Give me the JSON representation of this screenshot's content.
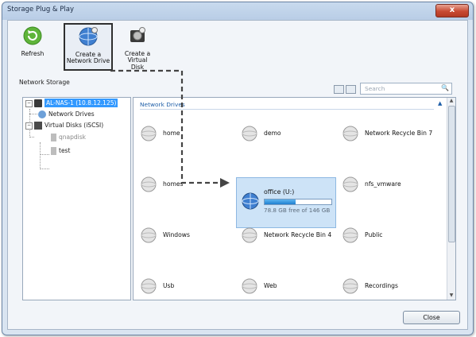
{
  "window": {
    "title": "Storage Plug & Play",
    "close_glyph": "x"
  },
  "toolbar": {
    "refresh_label": "Refresh",
    "create_network_drive_label": "Create a\nNetwork Drive",
    "create_virtual_disk_label": "Create a Virtual\nDisk"
  },
  "section_label": "Network Storage",
  "search": {
    "placeholder": "Search"
  },
  "tree": {
    "root": "AL-NAS-1 (10.8.12.125)",
    "network_drives": "Network Drives",
    "virtual_disks": "Virtual Disks (iSCSI)",
    "disks": [
      "qnapdisk",
      "test"
    ]
  },
  "main": {
    "group_label": "Network Drives",
    "drives": [
      "home",
      "demo",
      "Network Recycle Bin 7",
      "homes",
      "nfs_vmware",
      "Windows",
      "Network Recycle Bin 4",
      "Public",
      "Usb",
      "Web",
      "Recordings"
    ],
    "selected": {
      "name": "office (U:)",
      "capacity": "78.8 GB free of 146 GB",
      "used_fraction": 0.46
    }
  },
  "footer": {
    "close_label": "Close"
  },
  "colors": {
    "accent": "#3399ff",
    "title_bar": "#c8daee",
    "close_red": "#c84a32",
    "dashed_arrow": "#444444"
  }
}
